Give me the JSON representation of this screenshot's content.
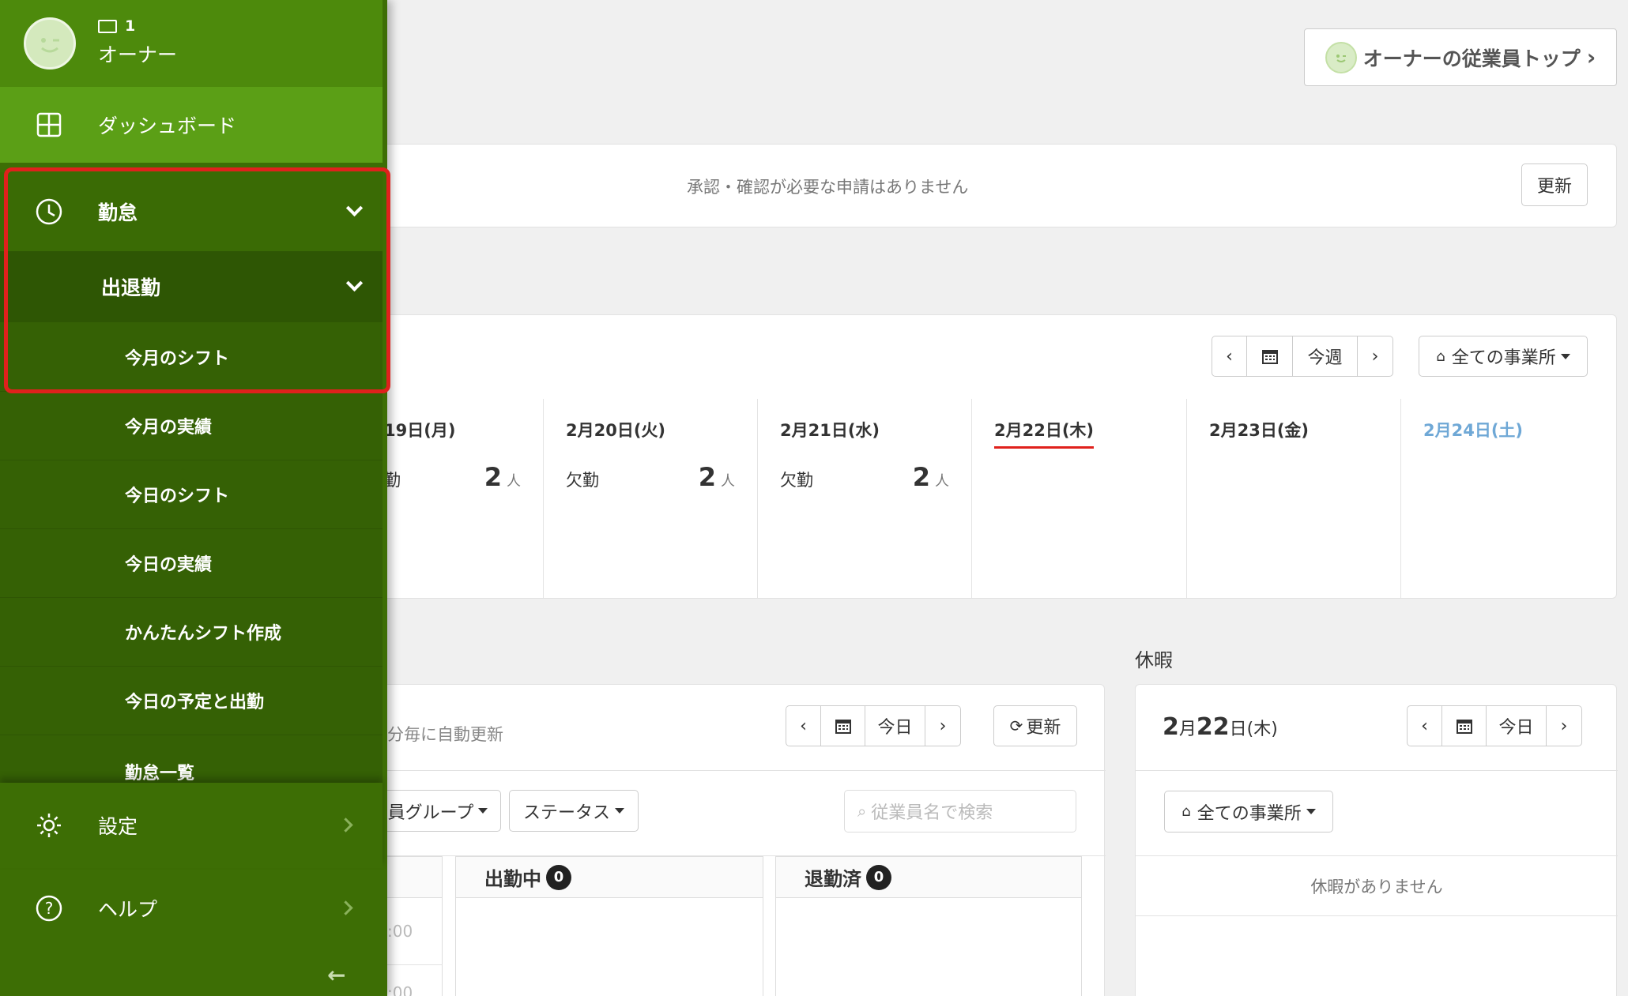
{
  "header": {
    "owner_top_label": "オーナーの従業員トップ"
  },
  "approvals": {
    "message": "承認・確認が必要な申請はありません",
    "refresh_label": "更新"
  },
  "week": {
    "prev": "‹",
    "next": "›",
    "this_week": "今週",
    "office_filter": "全ての事業所",
    "days": [
      {
        "date": "19日(月)",
        "status": "勤",
        "count": "2",
        "unit": "人"
      },
      {
        "date": "2月20日(火)",
        "status": "欠勤",
        "count": "2",
        "unit": "人"
      },
      {
        "date": "2月21日(水)",
        "status": "欠勤",
        "count": "2",
        "unit": "人"
      },
      {
        "date": "2月22日(木)"
      },
      {
        "date": "2月23日(金)"
      },
      {
        "date": "2月24日(土)"
      }
    ]
  },
  "attendance": {
    "auto_refresh": "分毎に自動更新",
    "today": "今日",
    "refresh_label": "更新",
    "group_filter": "員グループ",
    "status_filter": "ステータス",
    "search_placeholder": "従業員名で検索",
    "col_working": "出勤中",
    "col_working_count": "0",
    "col_left": "退勤済",
    "col_left_count": "0",
    "times": [
      ":00",
      ":00"
    ]
  },
  "leave": {
    "title": "休暇",
    "date_month": "2",
    "date_month_suffix": "月",
    "date_day": "22",
    "date_day_suffix": "日(木)",
    "today": "今日",
    "office_filter": "全ての事業所",
    "empty": "休暇がありません"
  },
  "sidebar": {
    "id": "1",
    "name": "オーナー",
    "dashboard": "ダッシュボード",
    "attendance": "勤怠",
    "clock": "出退勤",
    "items": [
      "今月のシフト",
      "今月の実績",
      "今日のシフト",
      "今日の実績",
      "かんたんシフト作成",
      "今日の予定と出勤",
      "勤怠一覧"
    ],
    "settings": "設定",
    "help": "ヘルプ",
    "collapse": "←"
  },
  "colors": {
    "sidebar_bg": "#3d6e05",
    "sidebar_active": "#5b9f16",
    "highlight": "#e0211c",
    "today_underline": "#e0211c",
    "saturday": "#6fa8d6"
  }
}
